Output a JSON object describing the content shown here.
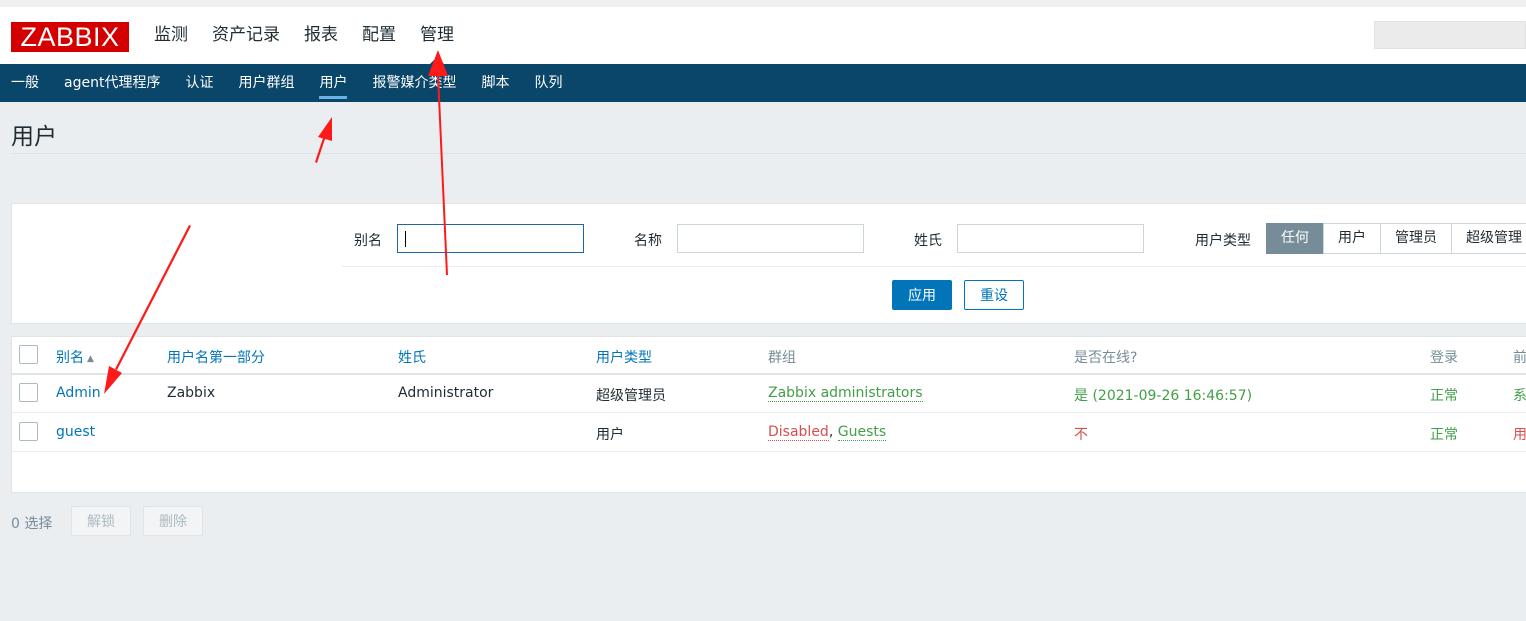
{
  "header": {
    "logo": "ZABBIX",
    "nav": [
      {
        "label": "监测"
      },
      {
        "label": "资产记录"
      },
      {
        "label": "报表"
      },
      {
        "label": "配置"
      },
      {
        "label": "管理",
        "active": true
      }
    ]
  },
  "subnav": [
    {
      "label": "一般"
    },
    {
      "label": "agent代理程序"
    },
    {
      "label": "认证"
    },
    {
      "label": "用户群组"
    },
    {
      "label": "用户",
      "active": true
    },
    {
      "label": "报警媒介类型"
    },
    {
      "label": "脚本"
    },
    {
      "label": "队列"
    }
  ],
  "page": {
    "title": "用户"
  },
  "filter": {
    "alias_label": "别名",
    "alias_value": "",
    "name_label": "名称",
    "name_value": "",
    "surname_label": "姓氏",
    "surname_value": "",
    "type_label": "用户类型",
    "type_options": [
      "任何",
      "用户",
      "管理员",
      "超级管理"
    ],
    "type_selected": "任何",
    "apply": "应用",
    "reset": "重设"
  },
  "table": {
    "headers": [
      "别名",
      "用户名第一部分",
      "姓氏",
      "用户类型",
      "群组",
      "是否在线?",
      "登录",
      "前"
    ],
    "rows": [
      {
        "alias": "Admin",
        "name": "Zabbix",
        "surname": "Administrator",
        "type": "超级管理员",
        "groups": [
          "Zabbix administrators"
        ],
        "online": "是 (2021-09-26 16:46:57)",
        "login": "正常",
        "frontend": "系"
      },
      {
        "alias": "guest",
        "name": "",
        "surname": "",
        "type": "用户",
        "groups": [
          "Disabled",
          "Guests"
        ],
        "group_sep": ",",
        "online": "不",
        "login": "正常",
        "frontend": "用"
      }
    ]
  },
  "footer": {
    "selected": "0 选择",
    "unlock": "解锁",
    "delete": "删除"
  },
  "colors": {
    "accent": "#0275b8",
    "nav_bg": "#0a466a",
    "logo_red": "#d40000",
    "ok_green": "#429e47",
    "alert_red": "#d64e4e",
    "annotation_arrow": "#ff1a1a"
  }
}
